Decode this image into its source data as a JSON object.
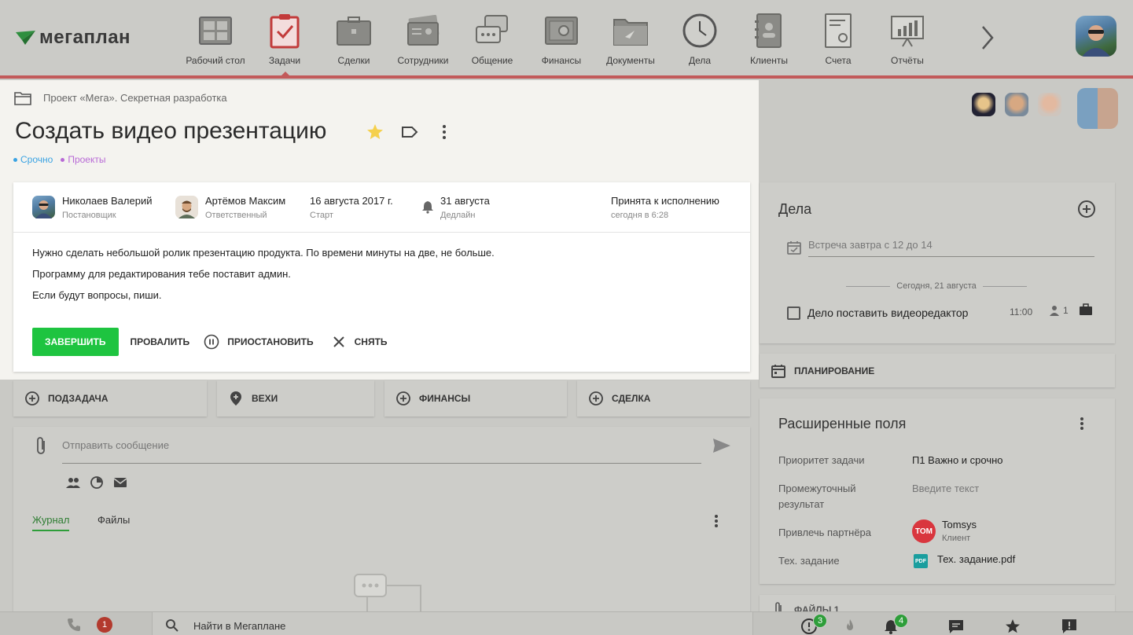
{
  "app": {
    "logo_text": "мегаплан"
  },
  "nav": {
    "items": [
      {
        "label": "Рабочий стол",
        "icon": "desktop-icon"
      },
      {
        "label": "Задачи",
        "icon": "tasks-clipboard-icon"
      },
      {
        "label": "Сделки",
        "icon": "briefcase-icon"
      },
      {
        "label": "Сотрудники",
        "icon": "employees-card-icon"
      },
      {
        "label": "Общение",
        "icon": "chat-icon"
      },
      {
        "label": "Финансы",
        "icon": "safe-icon"
      },
      {
        "label": "Документы",
        "icon": "folder-icon"
      },
      {
        "label": "Дела",
        "icon": "clock-icon"
      },
      {
        "label": "Клиенты",
        "icon": "address-book-icon"
      },
      {
        "label": "Счета",
        "icon": "invoice-icon"
      },
      {
        "label": "Отчёты",
        "icon": "report-chart-icon"
      }
    ],
    "active_index": 1
  },
  "task": {
    "breadcrumb": "Проект «Мега». Секретная разработка",
    "title": "Создать видео презентацию",
    "tags": [
      {
        "label": "Срочно",
        "color": "#3aa3e3"
      },
      {
        "label": "Проекты",
        "color": "#b86ad6"
      }
    ],
    "author": {
      "name": "Николаев Валерий",
      "role": "Постановщик"
    },
    "assignee": {
      "name": "Артёмов Максим",
      "role": "Ответственный"
    },
    "start": {
      "value": "16 августа 2017 г.",
      "label": "Старт"
    },
    "deadline": {
      "value": "31 августа",
      "label": "Дедлайн"
    },
    "status": {
      "value": "Принята к исполнению",
      "time": "сегодня в 6:28"
    },
    "description": [
      "Нужно сделать небольшой ролик презентацию продукта. По времени минуты на две, не больше.",
      "Программу для редактирования тебе поставит админ.",
      "Если будут вопросы, пиши."
    ],
    "actions": {
      "complete": "ЗАВЕРШИТЬ",
      "fail": "ПРОВАЛИТЬ",
      "pause": "ПРИОСТАНОВИТЬ",
      "remove": "СНЯТЬ"
    }
  },
  "subtabs": {
    "subtask": "ПОДЗАДАЧА",
    "milestones": "ВЕХИ",
    "finance": "ФИНАНСЫ",
    "deal": "СДЕЛКА"
  },
  "message": {
    "placeholder": "Отправить сообщение",
    "tabs": {
      "journal": "Журнал",
      "files": "Файлы"
    }
  },
  "dela": {
    "title": "Дела",
    "input_placeholder": "Встреча завтра с 12 до 14",
    "date_separator": "Сегодня, 21 августа",
    "item": {
      "text": "Дело поставить видеоредактор",
      "time": "11:00",
      "people": "1"
    }
  },
  "planning": {
    "label": "ПЛАНИРОВАНИЕ"
  },
  "extended_fields": {
    "title": "Расширенные поля",
    "priority": {
      "label": "Приоритет задачи",
      "value": "П1 Важно и срочно"
    },
    "intermediate": {
      "label": "Промежуточный результат",
      "placeholder": "Введите текст"
    },
    "partner": {
      "label": "Привлечь партнёра",
      "name": "Tomsys",
      "role": "Клиент"
    },
    "spec": {
      "label": "Тех. задание",
      "file": "Тех. задание.pdf"
    }
  },
  "files_section": {
    "label": "ФАЙЛЫ 1"
  },
  "bottombar": {
    "calls_badge": "1",
    "search_placeholder": "Найти в Мегаплане",
    "alerts_badge": "3",
    "notifications_badge": "4"
  }
}
